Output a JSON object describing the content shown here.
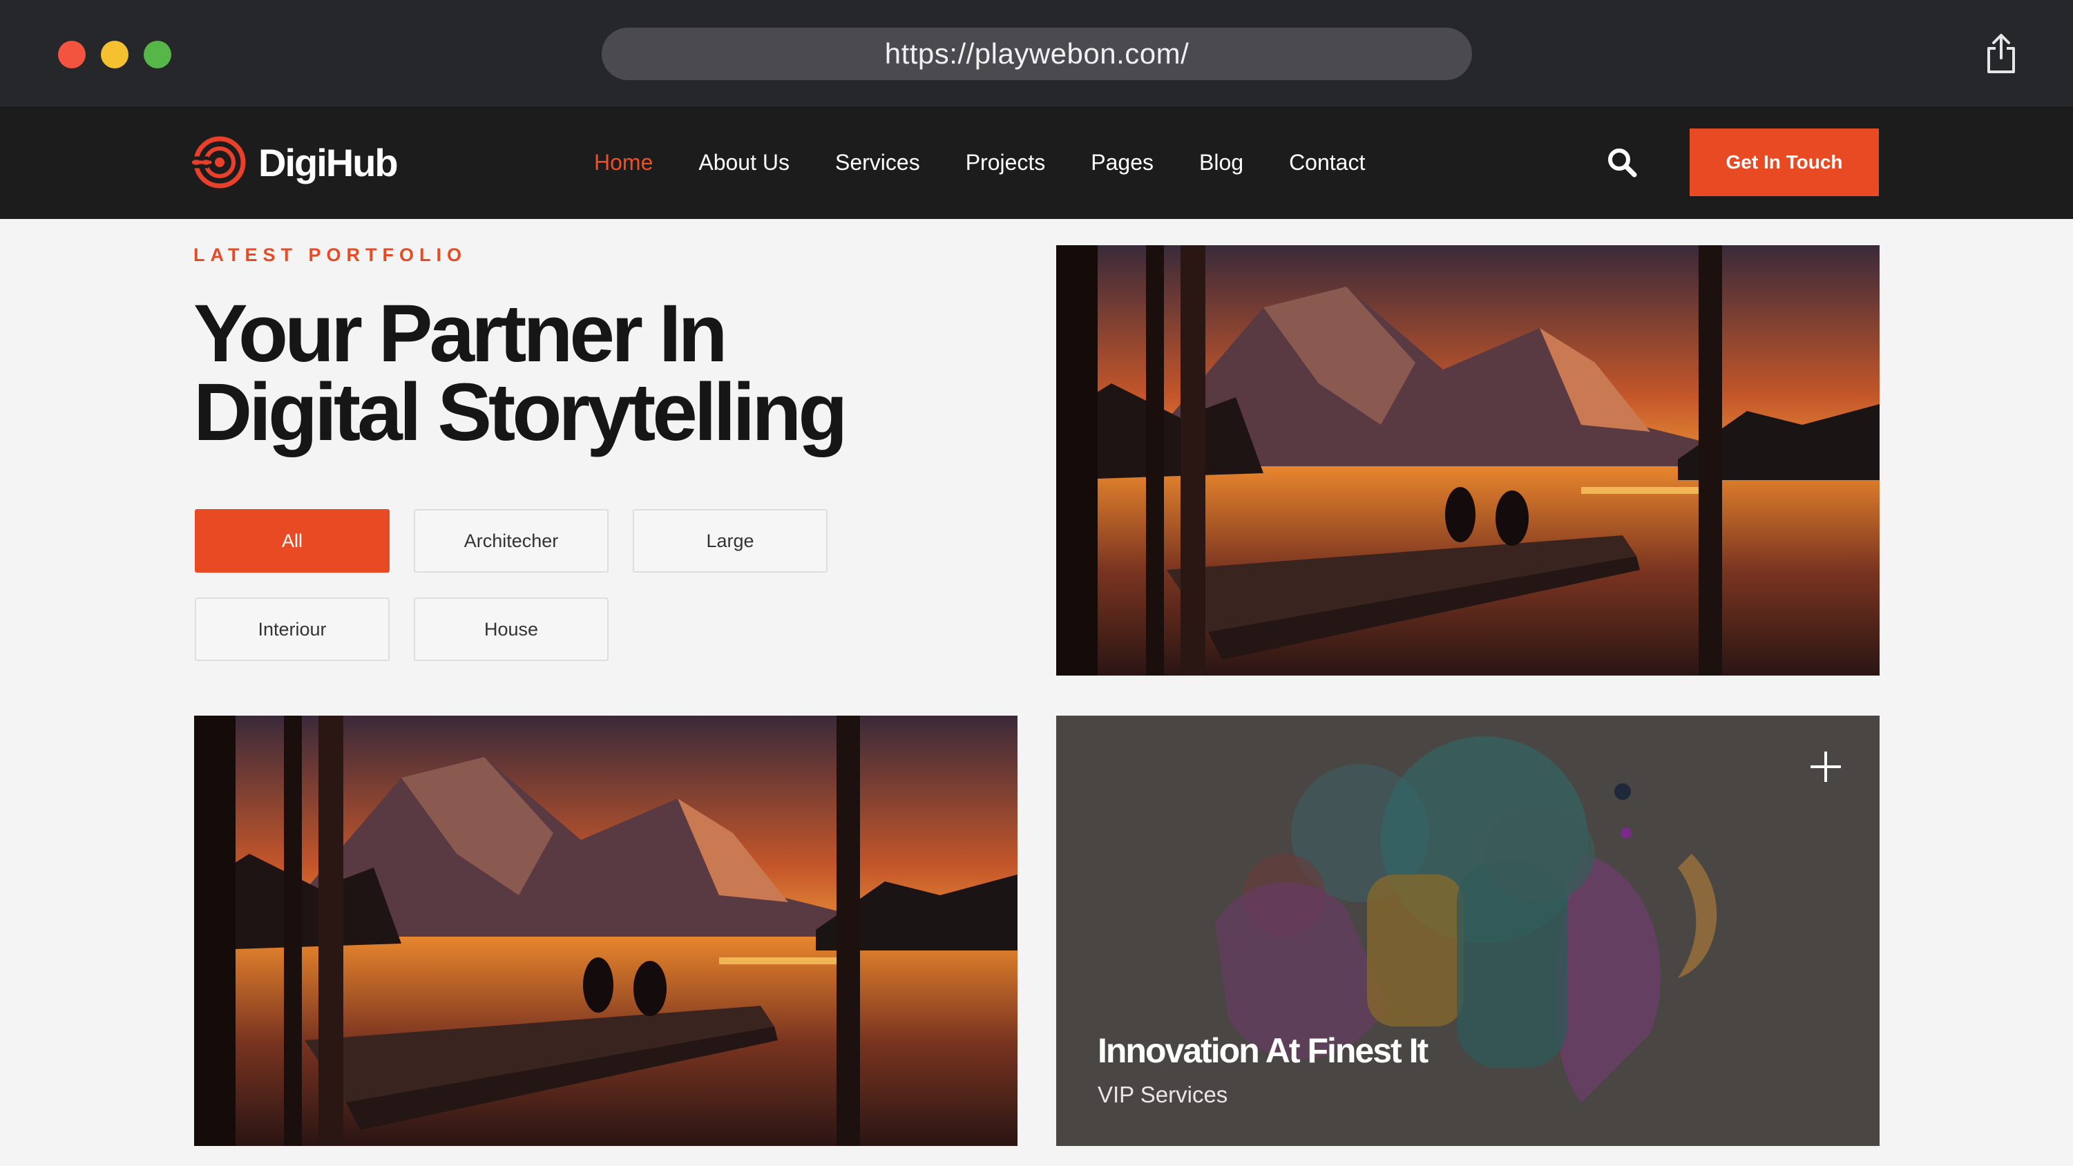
{
  "browser": {
    "url": "https://playwebon.com/"
  },
  "header": {
    "logo_text": "DigiHub",
    "nav": [
      {
        "label": "Home",
        "active": true
      },
      {
        "label": "About Us",
        "active": false
      },
      {
        "label": "Services",
        "active": false
      },
      {
        "label": "Projects",
        "active": false
      },
      {
        "label": "Pages",
        "active": false
      },
      {
        "label": "Blog",
        "active": false
      },
      {
        "label": "Contact",
        "active": false
      }
    ],
    "cta_label": "Get In Touch"
  },
  "intro": {
    "eyebrow": "LATEST PORTFOLIO",
    "headline_line1": "Your Partner In",
    "headline_line2": "Digital Storytelling"
  },
  "filters": [
    {
      "label": "All",
      "active": true
    },
    {
      "label": "Architecher",
      "active": false
    },
    {
      "label": "Large",
      "active": false
    },
    {
      "label": "Interiour",
      "active": false
    },
    {
      "label": "House",
      "active": false
    }
  ],
  "featured_card": {
    "title": "Innovation At Finest It",
    "subtitle": "VIP Services"
  },
  "colors": {
    "accent": "#e84b24",
    "header_bg": "#1c1c1c",
    "chrome_bg": "#26272b",
    "page_bg": "#f4f4f4"
  },
  "icons": {
    "logo": "digihub-logo-icon",
    "search": "search-icon",
    "share": "share-icon",
    "expand": "plus-icon"
  }
}
